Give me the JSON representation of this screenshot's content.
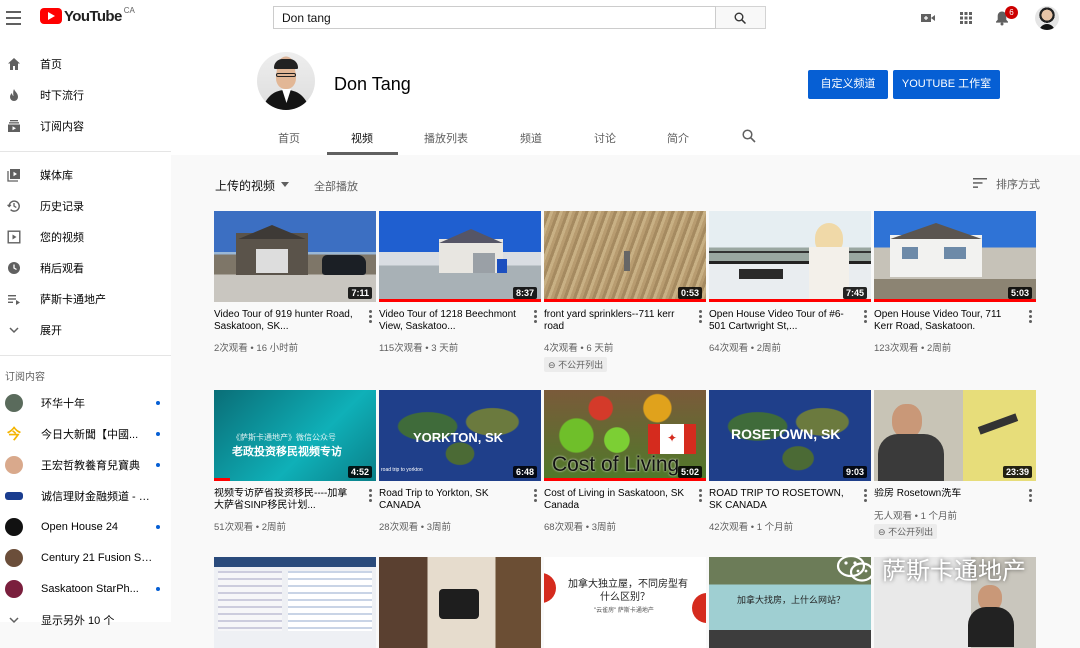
{
  "header": {
    "logo_text": "YouTube",
    "region": "CA",
    "search_value": "Don tang",
    "notification_count": "6"
  },
  "sidebar": {
    "main_items": [
      {
        "label": "首页",
        "icon": "home-icon"
      },
      {
        "label": "时下流行",
        "icon": "flame-icon"
      },
      {
        "label": "订阅内容",
        "icon": "subscriptions-icon"
      }
    ],
    "library_items": [
      {
        "label": "媒体库",
        "icon": "library-icon"
      },
      {
        "label": "历史记录",
        "icon": "history-icon"
      },
      {
        "label": "您的视频",
        "icon": "your-videos-icon"
      },
      {
        "label": "稍后观看",
        "icon": "watch-later-icon"
      },
      {
        "label": "萨斯卡通地产",
        "icon": "playlist-icon"
      },
      {
        "label": "展开",
        "icon": "chevron-down-icon"
      }
    ],
    "subscriptions_heading": "订阅内容",
    "subscriptions": [
      {
        "label": "环华十年",
        "color": "#5a6b5c",
        "dot": true
      },
      {
        "label": "今日大新聞【中國...",
        "color": "#f4b400",
        "dot": true
      },
      {
        "label": "王宏哲教養育兒寶典",
        "color": "#d9a98c",
        "dot": true
      },
      {
        "label": "诚信理财金融频道 - Fi...",
        "color": "#1a3d8f",
        "dot": false
      },
      {
        "label": "Open House 24",
        "color": "#111111",
        "dot": true
      },
      {
        "label": "Century 21 Fusion Sa...",
        "color": "#6b4e3a",
        "dot": false
      },
      {
        "label": "Saskatoon StarPh...",
        "color": "#7a1f3d",
        "dot": true
      },
      {
        "label": "显示另外 10 个",
        "color": "",
        "dot": false
      }
    ]
  },
  "channel": {
    "name": "Don Tang",
    "customize_button": "自定义频道",
    "studio_button": "YOUTUBE 工作室",
    "tabs": [
      "首页",
      "视频",
      "播放列表",
      "频道",
      "讨论",
      "简介"
    ],
    "active_tab": "视频"
  },
  "videos_section": {
    "title": "上传的视频",
    "play_all": "全部播放",
    "sort_label": "排序方式"
  },
  "videos": [
    {
      "title": "Video Tour of 919 hunter Road, Saskatoon, SK...",
      "views": "2次观看",
      "age": "16 小时前",
      "duration": "7:11",
      "unlisted": "",
      "progress": 0
    },
    {
      "title": "Video Tour of 1218 Beechmont View, Saskatoo...",
      "views": "115次观看",
      "age": "3 天前",
      "duration": "8:37",
      "unlisted": "",
      "progress": 100
    },
    {
      "title": "front yard sprinklers--711 kerr road",
      "views": "4次观看",
      "age": "6 天前",
      "duration": "0:53",
      "unlisted": "不公开列出",
      "progress": 100
    },
    {
      "title": "Open House Video Tour of #6-501 Cartwright St,...",
      "views": "64次观看",
      "age": "2周前",
      "duration": "7:45",
      "unlisted": "",
      "progress": 100
    },
    {
      "title": "Open House Video Tour, 711 Kerr Road, Saskatoon.",
      "views": "123次观看",
      "age": "2周前",
      "duration": "5:03",
      "unlisted": "",
      "progress": 100
    },
    {
      "title": "视频专访萨省投资移民----加拿大萨省SINP移民计划...",
      "views": "51次观看",
      "age": "2周前",
      "duration": "4:52",
      "unlisted": "",
      "progress": 10
    },
    {
      "title": "Road Trip to Yorkton, SK CANADA",
      "views": "28次观看",
      "age": "3周前",
      "duration": "6:48",
      "unlisted": "",
      "progress": 0
    },
    {
      "title": "Cost of Living in Saskatoon, SK Canada",
      "views": "68次观看",
      "age": "3周前",
      "duration": "5:02",
      "unlisted": "",
      "progress": 100
    },
    {
      "title": "ROAD TRIP TO ROSETOWN, SK CANADA",
      "views": "42次观看",
      "age": "1 个月前",
      "duration": "9:03",
      "unlisted": "",
      "progress": 0
    },
    {
      "title": "验房 Rosetown洗车",
      "views": "无人观看",
      "age": "1 个月前",
      "duration": "23:39",
      "unlisted": "不公开列出",
      "progress": 0
    }
  ],
  "thumb_text": {
    "v5_line1": "《萨斯卡通地产》微信公众号",
    "v5_line2": "老政投资移民视频专访",
    "v6_caption": "YORKTON, SK",
    "v6_small": "road trip to yorkton",
    "v7_caption": "Cost of Living",
    "v8_caption": "ROSETOWN, SK",
    "v12_line1": "加拿大独立屋，不同房型有",
    "v12_line2": "什么区别？",
    "v12_line3": "\"云雀房\" 萨斯卡通地产",
    "v13_caption": "加拿大找房，上什么网站？"
  },
  "watermark": "萨斯卡通地产",
  "colors": {
    "accent_blue": "#065fd4",
    "brand_red": "#ff0000",
    "badge_red": "#cc0000"
  }
}
